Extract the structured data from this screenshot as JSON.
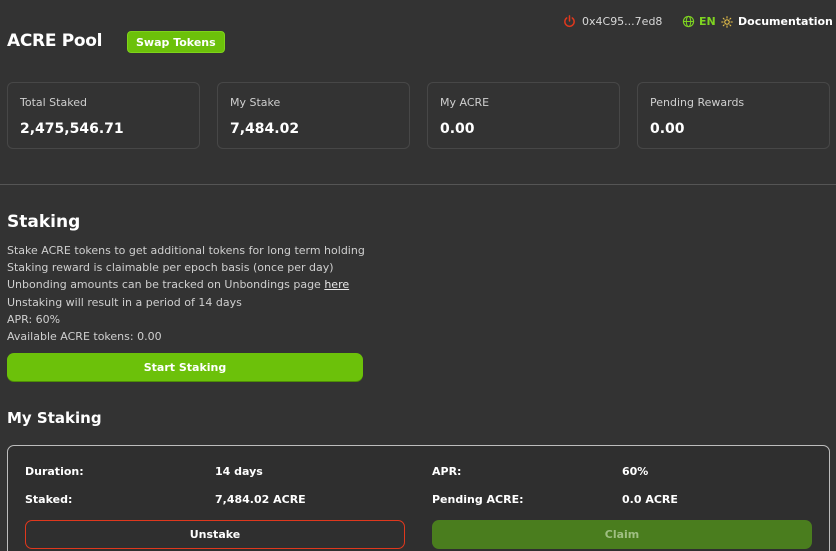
{
  "header": {
    "app_title": "ACRE Pool",
    "swap_button": "Swap Tokens",
    "wallet_address": "0x4C95...7ed8",
    "language": "EN",
    "documentation": "Documentation"
  },
  "stats": [
    {
      "label": "Total Staked",
      "value": "2,475,546.71"
    },
    {
      "label": "My Stake",
      "value": "7,484.02"
    },
    {
      "label": "My ACRE",
      "value": "0.00"
    },
    {
      "label": "Pending Rewards",
      "value": "0.00"
    }
  ],
  "staking": {
    "title": "Staking",
    "lines": [
      "Stake ACRE tokens to get additional tokens for long term holding",
      "Staking reward is claimable per epoch basis (once per day)",
      "Unbonding amounts can be tracked on Unbondings page ",
      "Unstaking will result in a period of 14 days",
      "APR: 60%",
      "Available ACRE tokens: 0.00"
    ],
    "here_link": "here",
    "start_button": "Start Staking"
  },
  "my_staking": {
    "title": "My Staking",
    "duration_label": "Duration:",
    "duration_value": "14 days",
    "apr_label": "APR:",
    "apr_value": "60%",
    "staked_label": "Staked:",
    "staked_value": "7,484.02 ACRE",
    "pending_label": "Pending ACRE:",
    "pending_value": "0.0 ACRE",
    "unstake_button": "Unstake",
    "claim_button": "Claim"
  },
  "colors": {
    "background": "#333333",
    "accent_green": "#6cc10a",
    "danger_red": "#e0381d",
    "claim_disabled": "#4a7d1e"
  },
  "icons": {
    "wallet": "power-icon",
    "language": "globe-icon",
    "theme": "sun-icon"
  }
}
